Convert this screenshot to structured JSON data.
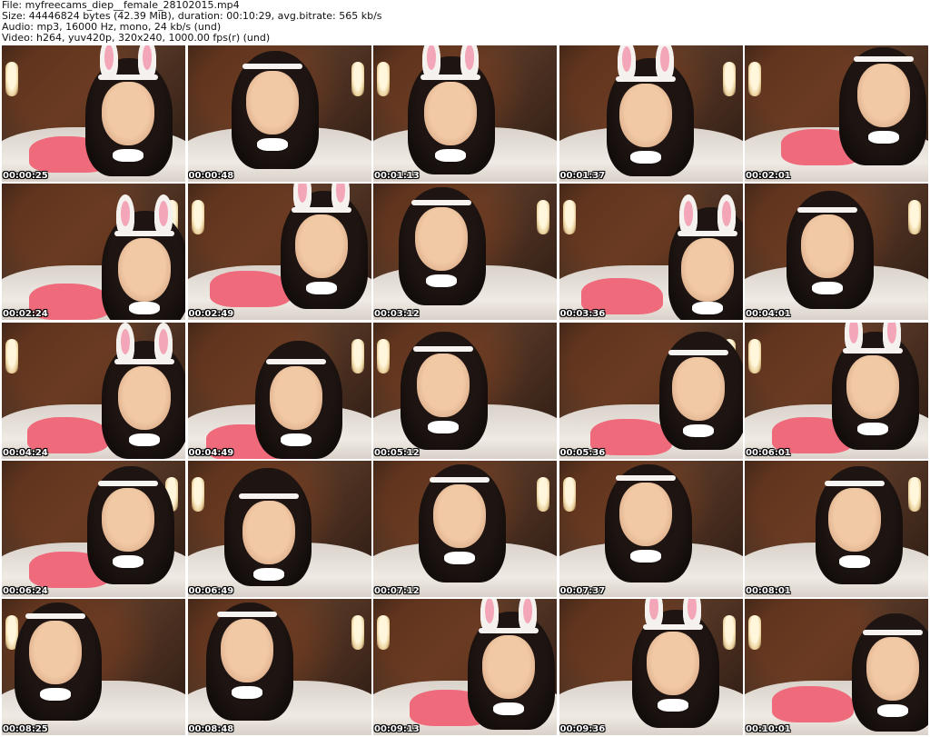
{
  "header": {
    "line1": "File: myfreecams_diep__female_28102015.mp4",
    "line2": "Size: 44446824 bytes (42.39 MiB), duration: 00:10:29, avg.bitrate: 565 kb/s",
    "line3": "Audio: mp3, 16000 Hz, mono, 24 kb/s (und)",
    "line4": "Video: h264, yuv420p, 320x240, 1000.00 fps(r) (und)"
  },
  "thumbnails": [
    {
      "time": "00:00:25"
    },
    {
      "time": "00:00:48"
    },
    {
      "time": "00:01:13"
    },
    {
      "time": "00:01:37"
    },
    {
      "time": "00:02:01"
    },
    {
      "time": "00:02:24"
    },
    {
      "time": "00:02:49"
    },
    {
      "time": "00:03:12"
    },
    {
      "time": "00:03:36"
    },
    {
      "time": "00:04:01"
    },
    {
      "time": "00:04:24"
    },
    {
      "time": "00:04:49"
    },
    {
      "time": "00:05:12"
    },
    {
      "time": "00:05:36"
    },
    {
      "time": "00:06:01"
    },
    {
      "time": "00:06:24"
    },
    {
      "time": "00:06:49"
    },
    {
      "time": "00:07:12"
    },
    {
      "time": "00:07:37"
    },
    {
      "time": "00:08:01"
    },
    {
      "time": "00:08:25"
    },
    {
      "time": "00:08:48"
    },
    {
      "time": "00:09:13"
    },
    {
      "time": "00:09:36"
    },
    {
      "time": "00:10:01"
    }
  ]
}
